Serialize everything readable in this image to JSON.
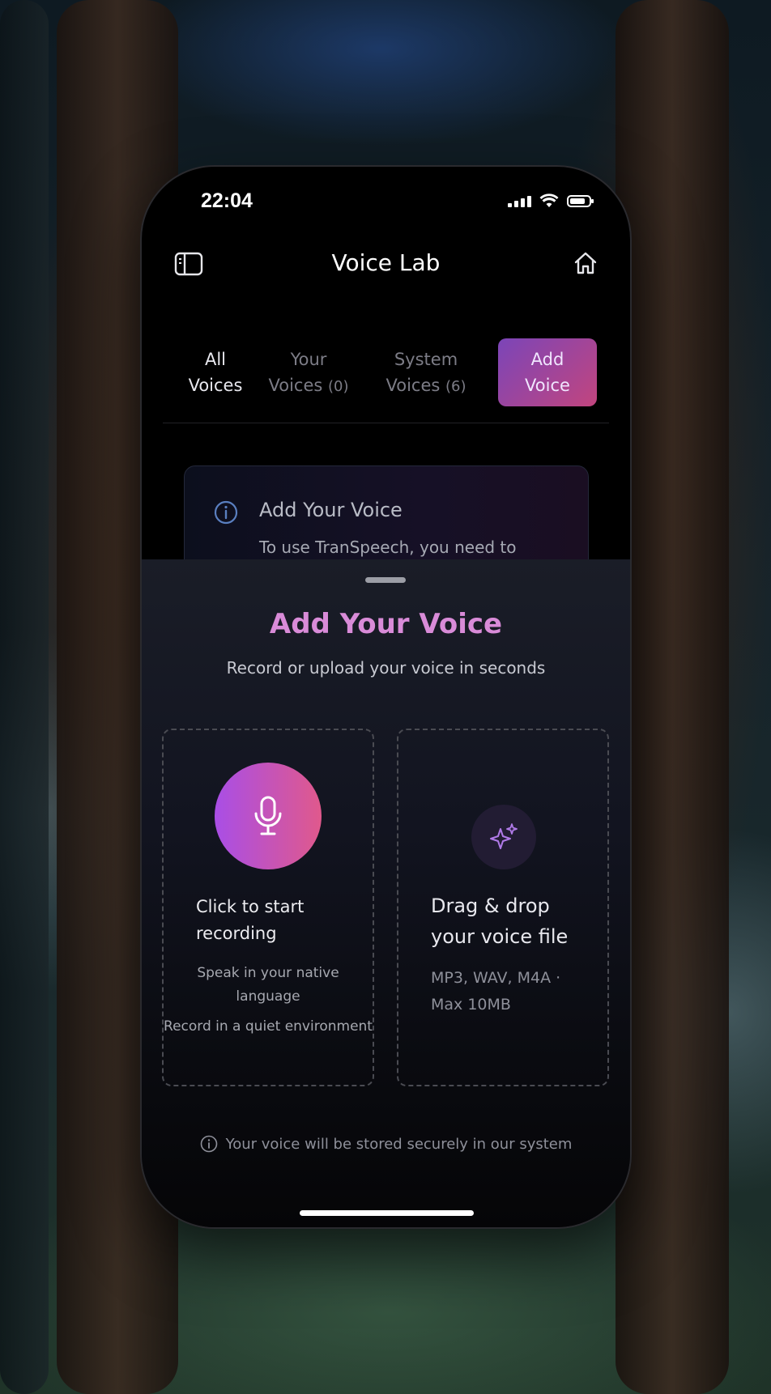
{
  "status_bar": {
    "time": "22:04"
  },
  "nav": {
    "title": "Voice Lab",
    "left_icon": "sidebar-icon",
    "right_icon": "home-icon"
  },
  "tabs": [
    {
      "line1": "All",
      "line2": "Voices",
      "count": ""
    },
    {
      "line1": "Your",
      "line2": "Voices",
      "count": "(0)"
    },
    {
      "line1": "System",
      "line2": "Voices",
      "count": "(6)"
    },
    {
      "line1": "Add",
      "line2": "Voice",
      "count": ""
    }
  ],
  "info_card": {
    "title": "Add Your Voice",
    "body": "To use TranSpeech, you need to"
  },
  "sheet": {
    "title": "Add Your Voice",
    "subtitle": "Record or upload your voice in seconds",
    "record": {
      "title": "Click to start recording",
      "tip1": "Speak in your native language",
      "tip2": "Record in a quiet environment"
    },
    "upload": {
      "title": "Drag & drop your voice file",
      "formats": "MP3, WAV, M4A · Max 10MB"
    },
    "secure_note": "Your voice will be stored securely in our system"
  },
  "colors": {
    "accent_start": "#7b45b8",
    "accent_end": "#c2457e",
    "title_pink": "#d98bd8",
    "mic_start": "#a94ee6",
    "mic_end": "#e0598c"
  }
}
